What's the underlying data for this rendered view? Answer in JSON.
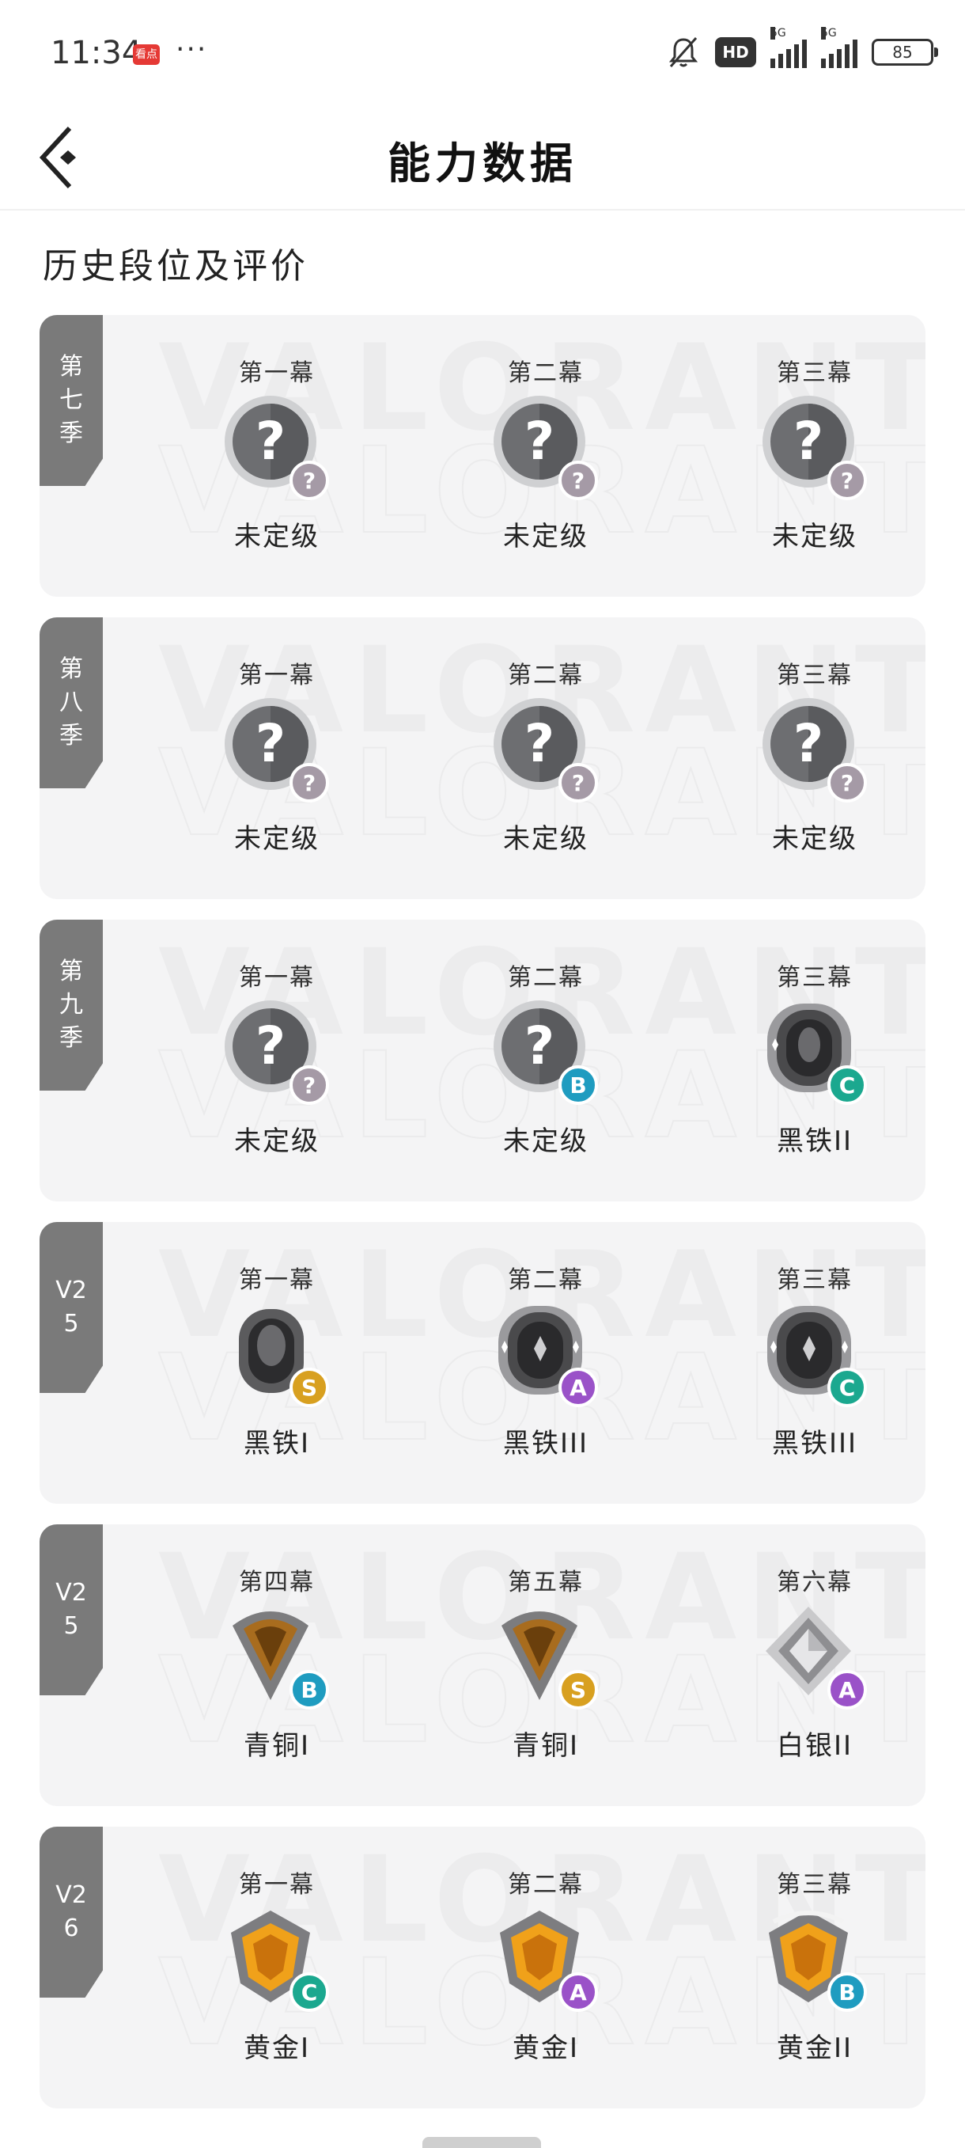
{
  "status_bar": {
    "time": "11:34",
    "app_icon_label": "看点",
    "dots": "···",
    "hd": "HD",
    "network_1": "5G",
    "network_2": "5G",
    "battery": "85"
  },
  "header": {
    "title": "能力数据"
  },
  "section_title": "历史段位及评价",
  "seasons": [
    {
      "label": "第七季",
      "acts": [
        {
          "act": "第一幕",
          "rank": "未定级",
          "icon": "unranked",
          "grade": "?"
        },
        {
          "act": "第二幕",
          "rank": "未定级",
          "icon": "unranked",
          "grade": "?"
        },
        {
          "act": "第三幕",
          "rank": "未定级",
          "icon": "unranked",
          "grade": "?"
        }
      ]
    },
    {
      "label": "第八季",
      "acts": [
        {
          "act": "第一幕",
          "rank": "未定级",
          "icon": "unranked",
          "grade": "?"
        },
        {
          "act": "第二幕",
          "rank": "未定级",
          "icon": "unranked",
          "grade": "?"
        },
        {
          "act": "第三幕",
          "rank": "未定级",
          "icon": "unranked",
          "grade": "?"
        }
      ]
    },
    {
      "label": "第九季",
      "acts": [
        {
          "act": "第一幕",
          "rank": "未定级",
          "icon": "unranked",
          "grade": "?"
        },
        {
          "act": "第二幕",
          "rank": "未定级",
          "icon": "unranked",
          "grade": "B"
        },
        {
          "act": "第三幕",
          "rank": "黑铁II",
          "icon": "iron2",
          "grade": "C"
        }
      ]
    },
    {
      "label": "V25",
      "acts": [
        {
          "act": "第一幕",
          "rank": "黑铁I",
          "icon": "iron1",
          "grade": "S"
        },
        {
          "act": "第二幕",
          "rank": "黑铁III",
          "icon": "iron3",
          "grade": "A"
        },
        {
          "act": "第三幕",
          "rank": "黑铁III",
          "icon": "iron3",
          "grade": "C"
        }
      ]
    },
    {
      "label": "V25",
      "acts": [
        {
          "act": "第四幕",
          "rank": "青铜I",
          "icon": "bronze",
          "grade": "B"
        },
        {
          "act": "第五幕",
          "rank": "青铜I",
          "icon": "bronze",
          "grade": "S"
        },
        {
          "act": "第六幕",
          "rank": "白银II",
          "icon": "silver",
          "grade": "A"
        }
      ]
    },
    {
      "label": "V26",
      "acts": [
        {
          "act": "第一幕",
          "rank": "黄金I",
          "icon": "gold1",
          "grade": "C"
        },
        {
          "act": "第二幕",
          "rank": "黄金I",
          "icon": "gold1",
          "grade": "A"
        },
        {
          "act": "第三幕",
          "rank": "黄金II",
          "icon": "gold2",
          "grade": "B"
        }
      ]
    }
  ],
  "colors": {
    "grade_S": "#d8a020",
    "grade_A": "#9a52c8",
    "grade_B": "#1f9cc0",
    "grade_C": "#1ba88f",
    "grade_unknown": "#a59aa6",
    "season_tab": "#7a7a7a",
    "card_bg": "#f4f4f5"
  }
}
